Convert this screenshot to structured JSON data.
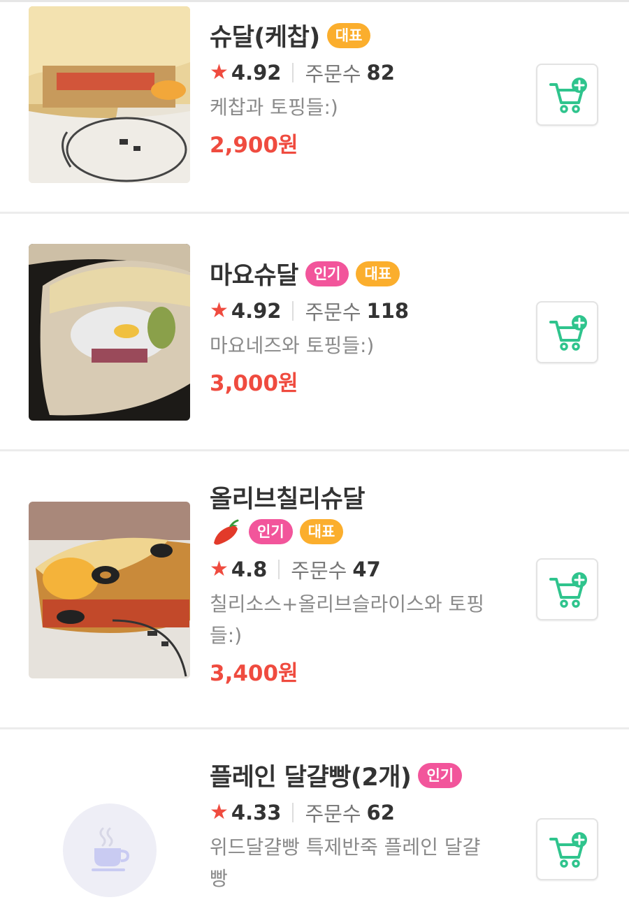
{
  "menu_items": [
    {
      "name": "슈달(케찹)",
      "badges": [
        "대표"
      ],
      "rating": "4.92",
      "orders_label": "주문수",
      "orders_count": "82",
      "description": "케찹과 토핑들:)",
      "price": "2,900원"
    },
    {
      "name": "마요슈달",
      "badges": [
        "인기",
        "대표"
      ],
      "rating": "4.92",
      "orders_label": "주문수",
      "orders_count": "118",
      "description": "마요네즈와 토핑들:)",
      "price": "3,000원"
    },
    {
      "name": "올리브칠리슈달",
      "badges": [
        "인기",
        "대표"
      ],
      "spicy_icon": "chili-pepper-icon",
      "rating": "4.8",
      "orders_label": "주문수",
      "orders_count": "47",
      "description": "칠리소스+올리브슬라이스와 토핑들:)",
      "price": "3,400원"
    },
    {
      "name": "플레인 달걀빵(2개)",
      "badges": [
        "인기"
      ],
      "rating": "4.33",
      "orders_label": "주문수",
      "orders_count": "62",
      "description": "위드달걀빵 특제반죽 플레인 달걀빵",
      "image_placeholder_icon": "coffee-cup-icon"
    }
  ],
  "icons": {
    "rating": "star-icon",
    "cart_button": "cart-plus-icon"
  },
  "colors": {
    "price": "#ef4b3f",
    "star": "#ef4b3f",
    "badge_popular": "#f2559b",
    "badge_signature": "#fbae2d",
    "cart_icon": "#2fc48d"
  }
}
